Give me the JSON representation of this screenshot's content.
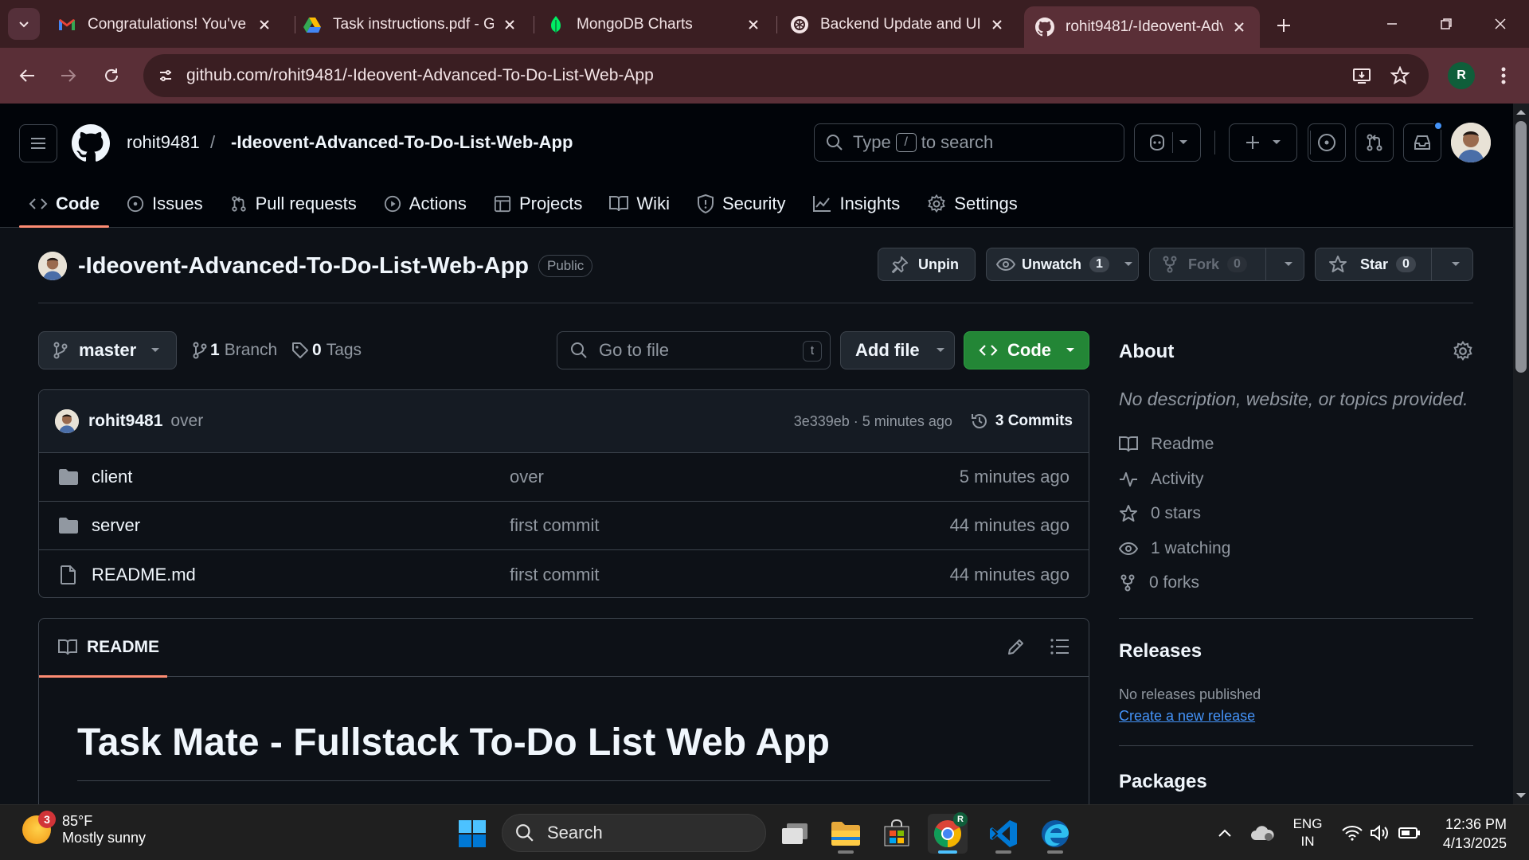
{
  "browser": {
    "tabs": [
      {
        "title": "Congratulations! You've b",
        "icon": "gmail-icon"
      },
      {
        "title": "Task instructions.pdf - Go",
        "icon": "google-drive-icon"
      },
      {
        "title": "MongoDB Charts",
        "icon": "mongodb-icon"
      },
      {
        "title": "Backend Update and UI",
        "icon": "chatgpt-icon"
      },
      {
        "title": "rohit9481/-Ideovent-Adv",
        "icon": "github-icon",
        "active": true
      }
    ],
    "url": "github.com/rohit9481/-Ideovent-Advanced-To-Do-List-Web-App",
    "profile_initial": "R"
  },
  "header": {
    "owner": "rohit9481",
    "separator": "/",
    "repo": "-Ideovent-Advanced-To-Do-List-Web-App",
    "search": {
      "prefix": "Type",
      "key": "/",
      "suffix": "to search"
    }
  },
  "repo_nav": [
    {
      "label": "Code",
      "icon": "code-icon",
      "active": true
    },
    {
      "label": "Issues",
      "icon": "issue-opened-icon"
    },
    {
      "label": "Pull requests",
      "icon": "pull-request-icon"
    },
    {
      "label": "Actions",
      "icon": "play-icon"
    },
    {
      "label": "Projects",
      "icon": "table-icon"
    },
    {
      "label": "Wiki",
      "icon": "book-icon"
    },
    {
      "label": "Security",
      "icon": "shield-icon"
    },
    {
      "label": "Insights",
      "icon": "graph-icon"
    },
    {
      "label": "Settings",
      "icon": "gear-icon"
    }
  ],
  "repo_header": {
    "name": "-Ideovent-Advanced-To-Do-List-Web-App",
    "visibility": "Public",
    "unpin": "Unpin",
    "unwatch": "Unwatch",
    "watch_count": "1",
    "fork": "Fork",
    "fork_count": "0",
    "star": "Star",
    "star_count": "0"
  },
  "toolbar": {
    "branch": "master",
    "branch_count": "1",
    "branch_label": "Branch",
    "tag_count": "0",
    "tag_label": "Tags",
    "goto_file": "Go to file",
    "goto_key": "t",
    "add_file": "Add file",
    "code": "Code"
  },
  "latest_commit": {
    "author": "rohit9481",
    "message": "over",
    "hash_time": "3e339eb · 5 minutes ago",
    "commits": "3 Commits"
  },
  "files": [
    {
      "name": "client",
      "type": "folder",
      "message": "over",
      "time": "5 minutes ago"
    },
    {
      "name": "server",
      "type": "folder",
      "message": "first commit",
      "time": "44 minutes ago"
    },
    {
      "name": "README.md",
      "type": "file",
      "message": "first commit",
      "time": "44 minutes ago"
    }
  ],
  "readme": {
    "tab": "README",
    "heading": "Task Mate - Fullstack To-Do List Web App"
  },
  "sidebar": {
    "about_title": "About",
    "about_desc": "No description, website, or topics provided.",
    "items": [
      {
        "label": "Readme",
        "icon": "book-icon"
      },
      {
        "label": "Activity",
        "icon": "pulse-icon"
      },
      {
        "label": "0 stars",
        "icon": "star-icon"
      },
      {
        "label": "1 watching",
        "icon": "eye-icon"
      },
      {
        "label": "0 forks",
        "icon": "fork-icon"
      }
    ],
    "releases_title": "Releases",
    "releases_text": "No releases published",
    "releases_link": "Create a new release",
    "packages_title": "Packages"
  },
  "taskbar": {
    "weather_badge": "3",
    "temp": "85°F",
    "condition": "Mostly sunny",
    "search": "Search",
    "lang": "ENG",
    "region": "IN",
    "time": "12:36 PM",
    "date": "4/13/2025",
    "chrome_badge": "R"
  },
  "colors": {
    "accent_underline": "#fd8c73",
    "green_button": "#238636",
    "link": "#4493f8",
    "browser_frame": "#5a2f37"
  }
}
